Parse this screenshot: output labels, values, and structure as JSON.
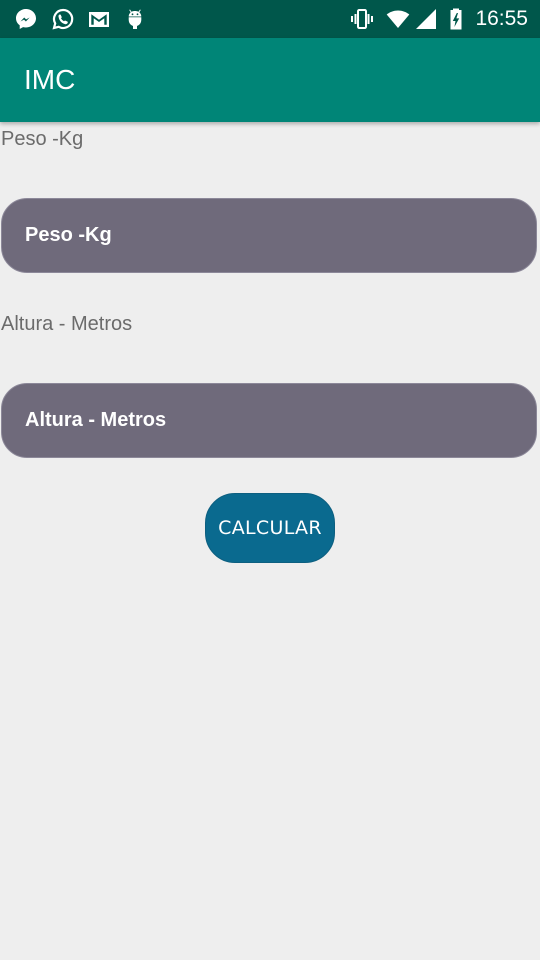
{
  "status_bar": {
    "time": "16:55",
    "left_icons": [
      "messenger-icon",
      "whatsapp-icon",
      "gmail-icon",
      "android-debug-icon"
    ],
    "right_icons": [
      "vibrate-icon",
      "wifi-icon",
      "cell-signal-icon",
      "battery-charging-icon"
    ]
  },
  "app_bar": {
    "title": "IMC"
  },
  "form": {
    "peso": {
      "label": "Peso -Kg",
      "placeholder": "Peso -Kg",
      "value": ""
    },
    "altura": {
      "label": "Altura - Metros",
      "placeholder": "Altura - Metros",
      "value": ""
    },
    "calculate_label": "CALCULAR"
  },
  "colors": {
    "status_bar": "#00574b",
    "app_bar": "#008577",
    "background": "#eeeeee",
    "input_fill": "#6f6a7b",
    "button": "#0a6a8f",
    "label_text": "#6b6b6b"
  }
}
